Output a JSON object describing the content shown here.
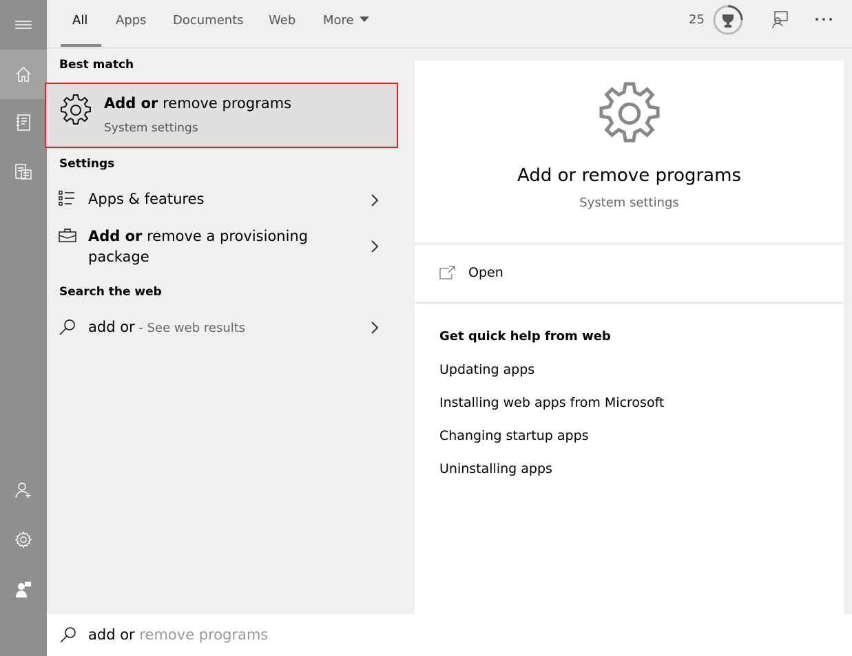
{
  "tabs": [
    {
      "label": "All"
    },
    {
      "label": "Apps"
    },
    {
      "label": "Documents"
    },
    {
      "label": "Web"
    },
    {
      "label": "More"
    }
  ],
  "header": {
    "points": "25"
  },
  "sections": {
    "best_match": "Best match",
    "settings": "Settings",
    "search_web": "Search the web"
  },
  "best_match": {
    "title_bold": "Add or",
    "title_rest": " remove programs",
    "subtitle": "System settings"
  },
  "settings_items": [
    {
      "label": "Apps & features"
    },
    {
      "label_bold": "Add or",
      "label_rest": " remove a provisioning",
      "label_line2": "package"
    }
  ],
  "web_item": {
    "query": "add or",
    "suffix": " - See web results"
  },
  "preview": {
    "title": "Add or remove programs",
    "subtitle": "System settings",
    "open_label": "Open",
    "help_heading": "Get quick help from web",
    "help_links": [
      "Updating apps",
      "Installing web apps from Microsoft",
      "Changing startup apps",
      "Uninstalling apps"
    ]
  },
  "search": {
    "typed": "add or",
    "suggestion": " remove programs"
  },
  "colors": {
    "highlight_border": "#e3232c",
    "rail": "#8f8f8f"
  }
}
